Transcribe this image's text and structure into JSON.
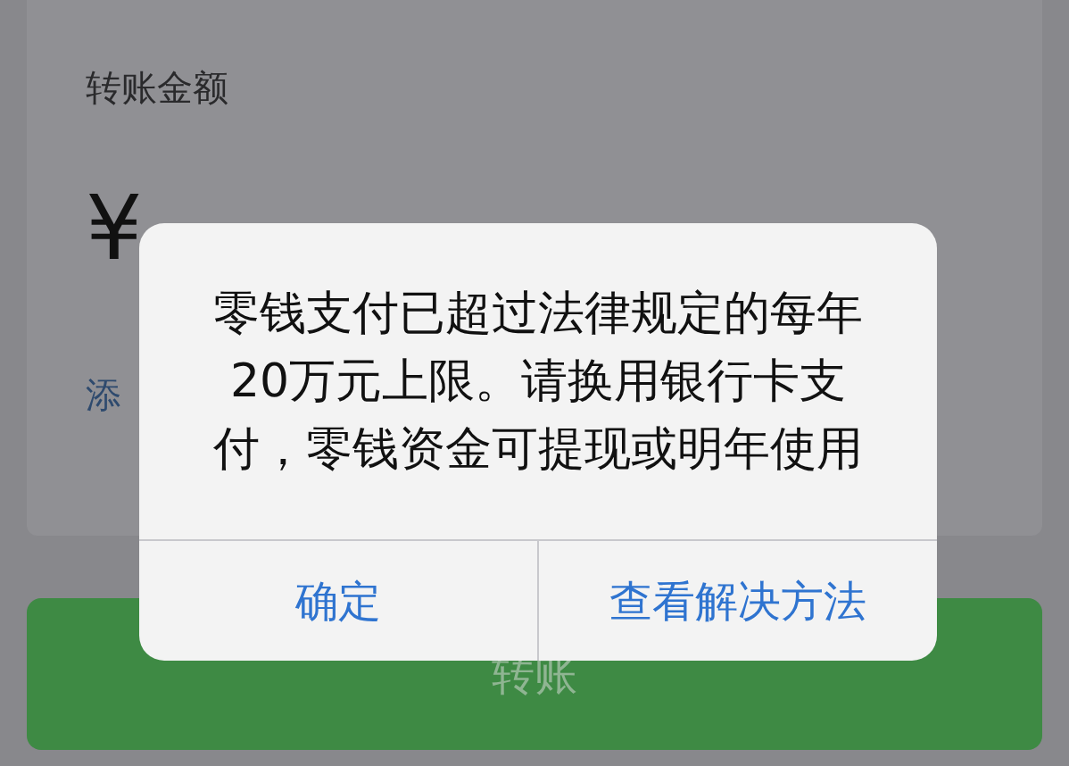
{
  "card": {
    "label": "转账金额",
    "currency": "¥",
    "note": "添"
  },
  "transfer_button": {
    "label": "转账"
  },
  "dialog": {
    "message": "零钱支付已超过法律规定的每年20万元上限。请换用银行卡支付，零钱资金可提现或明年使用",
    "buttons": [
      {
        "label": "确定"
      },
      {
        "label": "查看解决方法"
      }
    ]
  }
}
